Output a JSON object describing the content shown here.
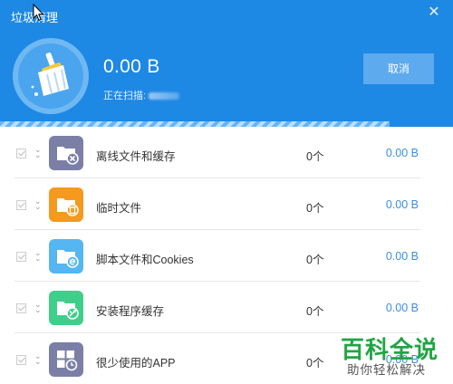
{
  "window": {
    "title": "垃圾清理"
  },
  "scan": {
    "size": "0.00 B",
    "status_label": "正在扫描:",
    "cancel_label": "取消",
    "progress": 0.86
  },
  "categories": [
    {
      "name": "离线文件和缓存",
      "count": "0个",
      "size": "0.00 B",
      "icon": "folder-delete-icon",
      "color": "#7b7fa6"
    },
    {
      "name": "临时文件",
      "count": "0个",
      "size": "0.00 B",
      "icon": "folder-trash-icon",
      "color": "#f59a1e"
    },
    {
      "name": "脚本文件和Cookies",
      "count": "0个",
      "size": "0.00 B",
      "icon": "folder-browser-icon",
      "color": "#55b6f2"
    },
    {
      "name": "安装程序缓存",
      "count": "0个",
      "size": "0.00 B",
      "icon": "folder-installer-icon",
      "color": "#3fcf8a"
    },
    {
      "name": "很少使用的APP",
      "count": "0个",
      "size": "0.00 B",
      "icon": "app-grid-clock-icon",
      "color": "#7b7fa6"
    }
  ],
  "watermark": {
    "main": "百科全说",
    "sub": "助你轻松解决"
  }
}
